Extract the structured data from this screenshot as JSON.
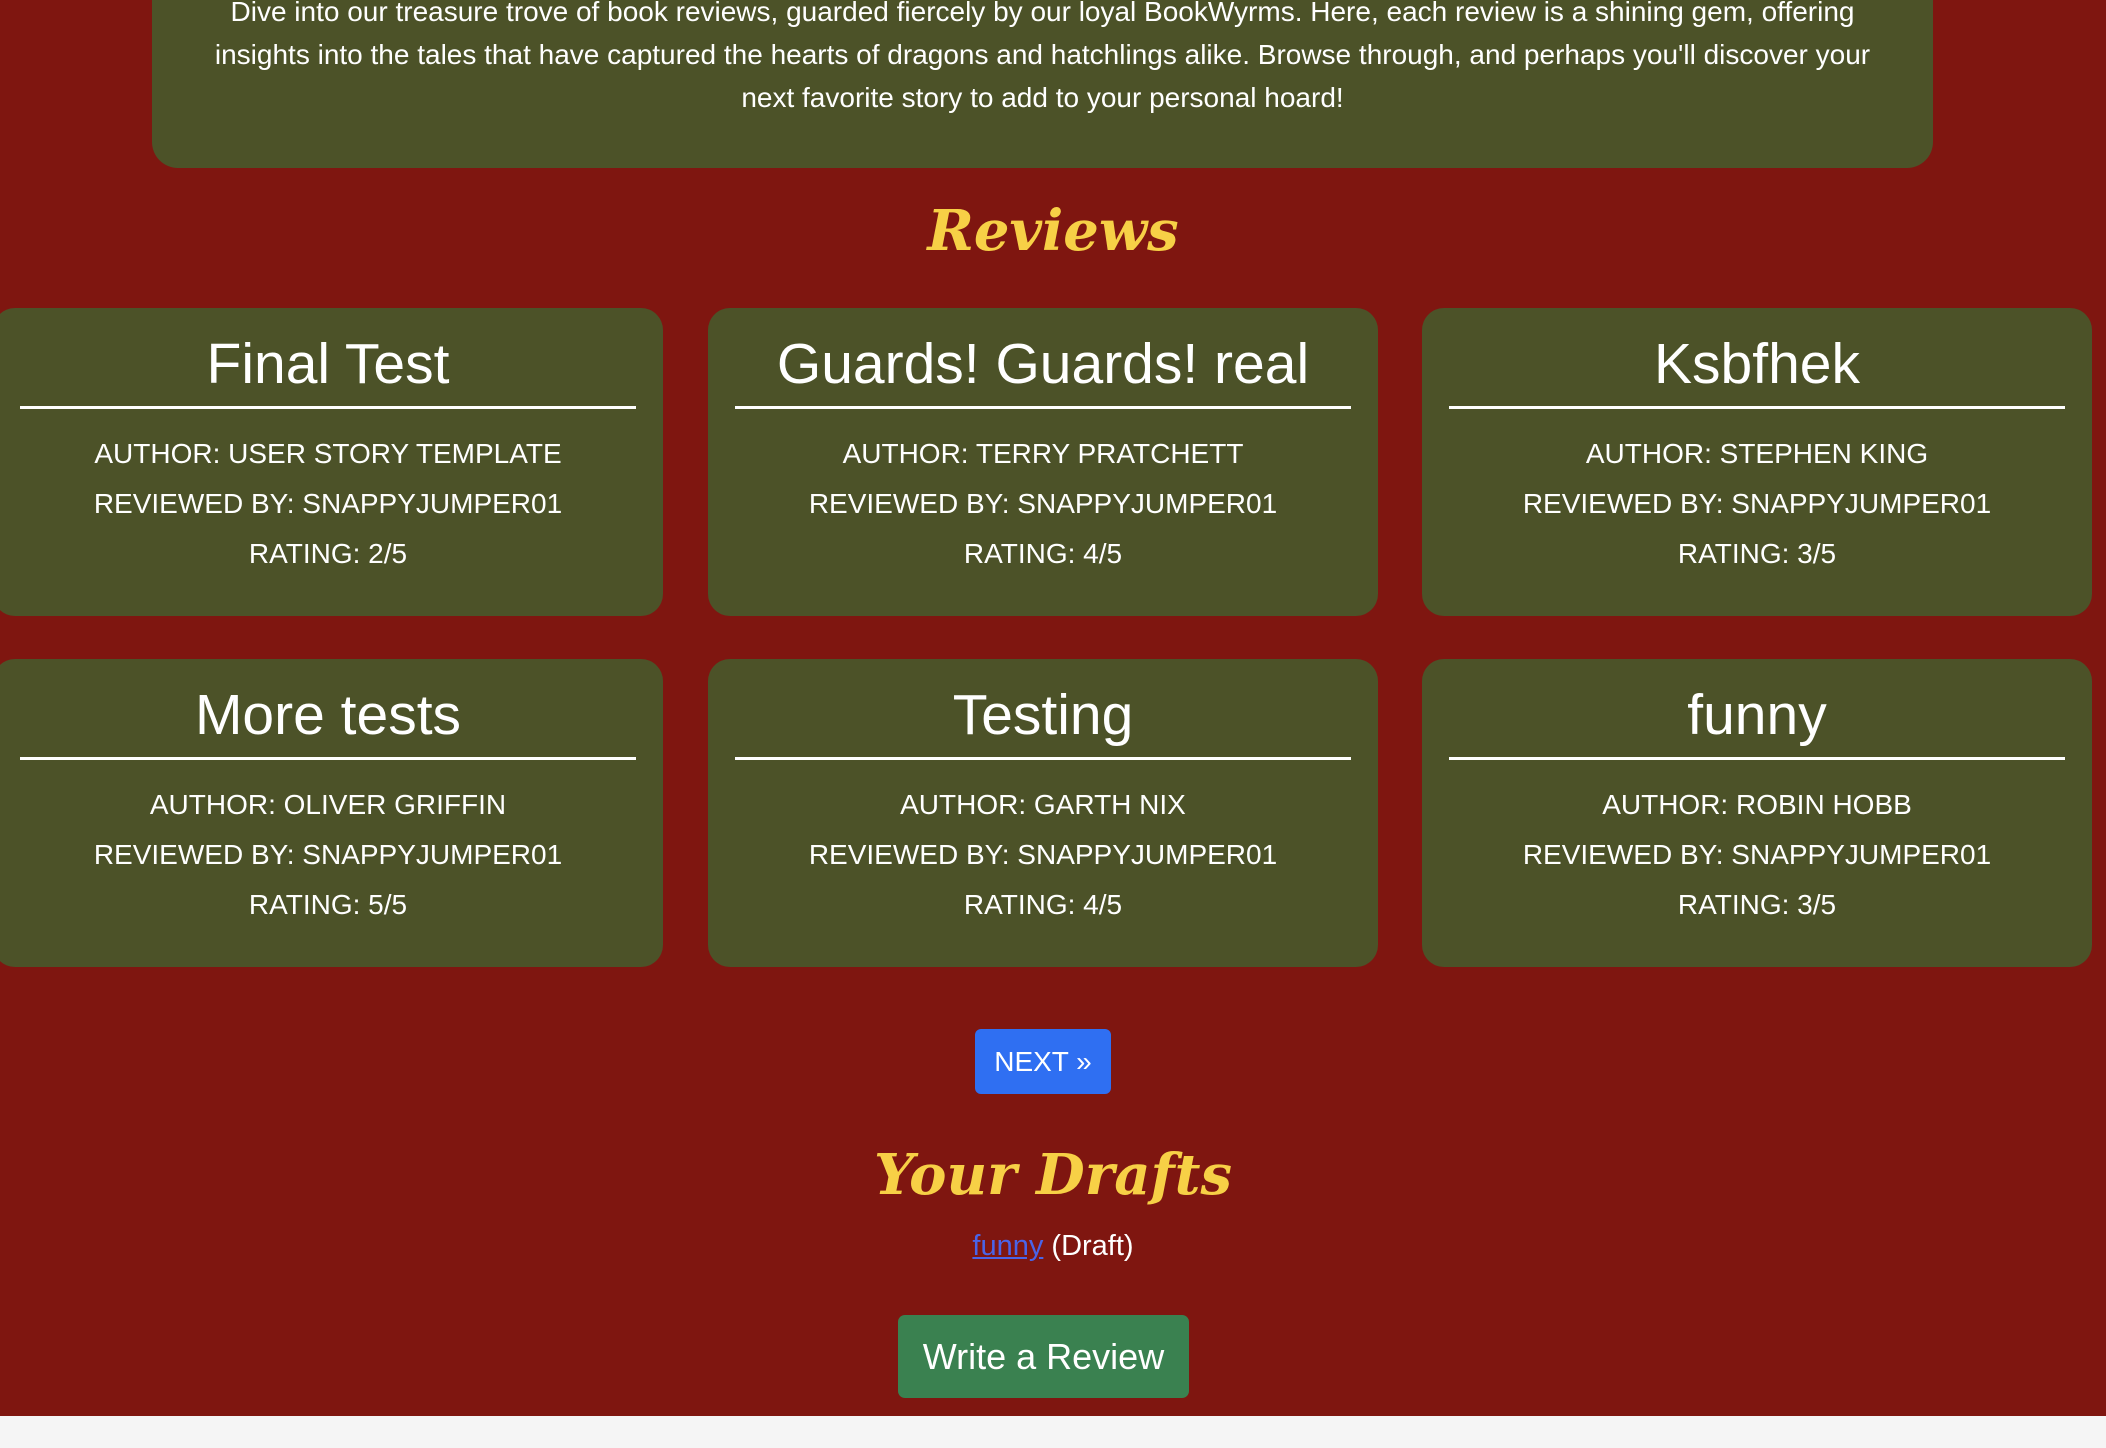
{
  "intro": {
    "text": "Dive into our treasure trove of book reviews, guarded fiercely by our loyal BookWyrms. Here, each review is a shining gem, offering insights into the tales that have captured the hearts of dragons and hatchlings alike. Browse through, and perhaps you'll discover your next favorite story to add to your personal hoard!"
  },
  "reviews": {
    "heading": "Reviews",
    "items": [
      {
        "title": "Final Test",
        "author": "AUTHOR: USER STORY TEMPLATE",
        "reviewed_by": "REVIEWED BY: SNAPPYJUMPER01",
        "rating": "RATING: 2/5"
      },
      {
        "title": "Guards! Guards! real",
        "author": "AUTHOR: TERRY PRATCHETT",
        "reviewed_by": "REVIEWED BY: SNAPPYJUMPER01",
        "rating": "RATING: 4/5"
      },
      {
        "title": "Ksbfhek",
        "author": "AUTHOR: STEPHEN KING",
        "reviewed_by": "REVIEWED BY: SNAPPYJUMPER01",
        "rating": "RATING: 3/5"
      },
      {
        "title": "More tests",
        "author": "AUTHOR: OLIVER GRIFFIN",
        "reviewed_by": "REVIEWED BY: SNAPPYJUMPER01",
        "rating": "RATING: 5/5"
      },
      {
        "title": "Testing",
        "author": "AUTHOR: GARTH NIX",
        "reviewed_by": "REVIEWED BY: SNAPPYJUMPER01",
        "rating": "RATING: 4/5"
      },
      {
        "title": "funny",
        "author": "AUTHOR: ROBIN HOBB",
        "reviewed_by": "REVIEWED BY: SNAPPYJUMPER01",
        "rating": "RATING: 3/5"
      }
    ]
  },
  "pagination": {
    "next_label": "NEXT »"
  },
  "drafts": {
    "heading": "Your Drafts",
    "items": [
      {
        "title": "funny",
        "status": "(Draft)"
      }
    ]
  },
  "actions": {
    "write_review_label": "Write a Review"
  },
  "colors": {
    "page_background": "#7f1610",
    "card_background": "#4c5228",
    "heading_accent": "#f7d046",
    "next_button": "#2f6ff2",
    "write_button": "#3a8150",
    "link": "#4a64e7"
  }
}
